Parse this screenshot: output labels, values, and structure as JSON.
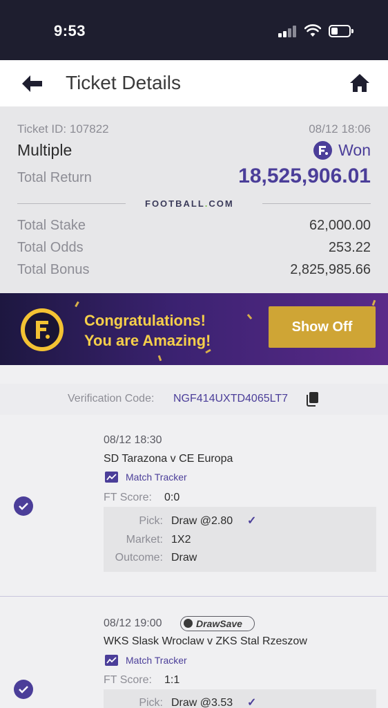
{
  "status_bar": {
    "time": "9:53"
  },
  "header": {
    "title": "Ticket Details"
  },
  "summary": {
    "ticket_id": "Ticket ID: 107822",
    "date": "08/12 18:06",
    "bet_type": "Multiple",
    "status": "Won",
    "total_return_label": "Total Return",
    "total_return_value": "18,525,906.01",
    "brand": "FOOTBALL",
    "brand_suffix": "COM",
    "rows": [
      {
        "label": "Total Stake",
        "value": "62,000.00"
      },
      {
        "label": "Total Odds",
        "value": "253.22"
      },
      {
        "label": "Total Bonus",
        "value": "2,825,985.66"
      }
    ]
  },
  "banner": {
    "line1": "Congratulations!",
    "line2": "You are Amazing!",
    "button": "Show Off"
  },
  "verification": {
    "label": "Verification Code:",
    "code": "NGF414UXTD4065LT7"
  },
  "matches": [
    {
      "date": "08/12 18:30",
      "teams": "SD Tarazona v CE Europa",
      "tracker": "Match Tracker",
      "score_label": "FT Score:",
      "score": "0:0",
      "pick_label": "Pick:",
      "pick": "Draw @2.80",
      "market_label": "Market:",
      "market": "1X2",
      "outcome_label": "Outcome:",
      "outcome": "Draw"
    },
    {
      "date": "08/12 19:00",
      "badge": "DrawSave",
      "teams": "WKS Slask Wroclaw v ZKS Stal Rzeszow",
      "tracker": "Match Tracker",
      "score_label": "FT Score:",
      "score": "1:1",
      "pick_label": "Pick:",
      "pick": "Draw @3.53"
    }
  ]
}
